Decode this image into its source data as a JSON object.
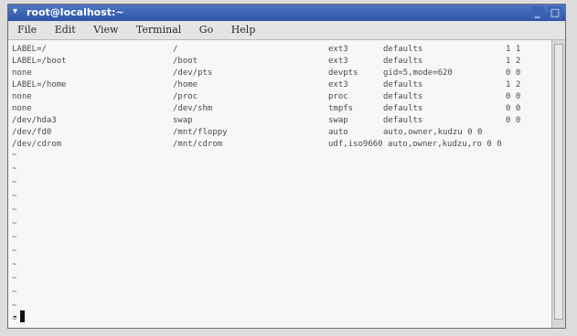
{
  "window": {
    "title": "root@localhost:~",
    "controls": {
      "minimize": "_",
      "close": "□"
    },
    "title_icon": "terminal-icon"
  },
  "menu": [
    "File",
    "Edit",
    "View",
    "Terminal",
    "Go",
    "Help"
  ],
  "fstab": [
    [
      "LABEL=/",
      "/",
      "ext3",
      "defaults",
      "1 1"
    ],
    [
      "LABEL=/boot",
      "/boot",
      "ext3",
      "defaults",
      "1 2"
    ],
    [
      "none",
      "/dev/pts",
      "devpts",
      "gid=5,mode=620",
      "0 0"
    ],
    [
      "LABEL=/home",
      "/home",
      "ext3",
      "defaults",
      "1 2"
    ],
    [
      "none",
      "/proc",
      "proc",
      "defaults",
      "0 0"
    ],
    [
      "none",
      "/dev/shm",
      "tmpfs",
      "defaults",
      "0 0"
    ],
    [
      "/dev/hda3",
      "swap",
      "swap",
      "defaults",
      "0 0"
    ],
    [
      "/dev/fd0",
      "/mnt/floppy",
      "auto",
      "auto,owner,kudzu 0 0",
      ""
    ],
    [
      "/dev/cdrom",
      "/mnt/cdrom",
      "udf,iso9660 auto,owner,kudzu,ro 0 0",
      "",
      ""
    ]
  ],
  "tilde": "~",
  "tilde_count": 13,
  "cmdline": "-"
}
